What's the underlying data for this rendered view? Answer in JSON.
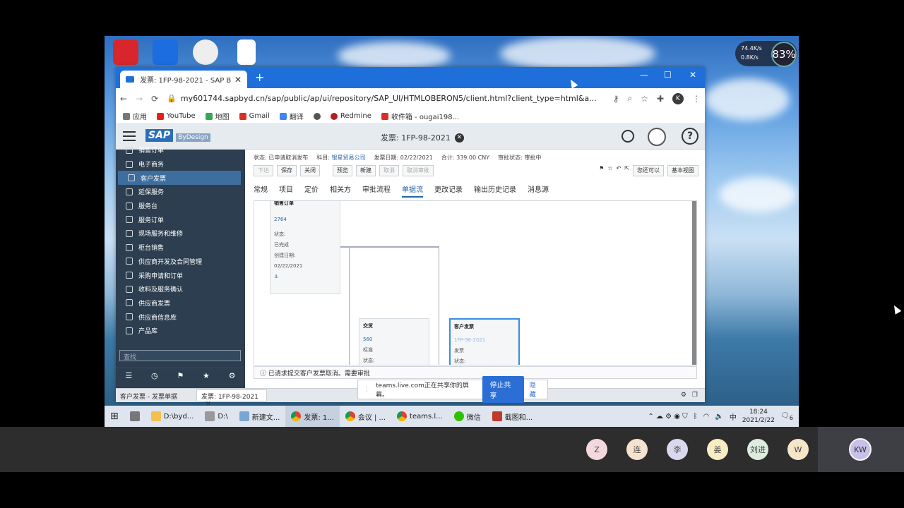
{
  "network_monitor": {
    "upload": "74.4K/s",
    "download": "0.8K/s",
    "cpu": "83%"
  },
  "browser": {
    "tab_title": "发票: 1FP-98-2021 - SAP Busin",
    "new_tab": "+",
    "url": "my601744.sapbyd.cn/sap/public/ap/ui/repository/SAP_UI/HTMLOBERON5/client.html?client_type=html&a...",
    "profile_initial": "K",
    "bookmarks": [
      "应用",
      "YouTube",
      "地图",
      "Gmail",
      "翻译",
      "Redmine",
      "收件箱 - ougai198..."
    ]
  },
  "sap": {
    "logo_text": "SAP",
    "logo_sub": "ByDesign",
    "doc_title": "发票: 1FP-98-2021",
    "sidebar": [
      {
        "label": "销售订单",
        "active": false
      },
      {
        "label": "电子商务",
        "active": false
      },
      {
        "label": "客户发票",
        "active": true
      },
      {
        "label": "延保服务",
        "active": false
      },
      {
        "label": "服务台",
        "active": false
      },
      {
        "label": "服务订单",
        "active": false
      },
      {
        "label": "现场服务和维修",
        "active": false
      },
      {
        "label": "柜台销售",
        "active": false
      },
      {
        "label": "供应商开发及合同管理",
        "active": false
      },
      {
        "label": "采购申请和订单",
        "active": false
      },
      {
        "label": "收料及服务确认",
        "active": false
      },
      {
        "label": "供应商发票",
        "active": false
      },
      {
        "label": "供应商信息库",
        "active": false
      },
      {
        "label": "产品库",
        "active": false
      }
    ],
    "search_placeholder": "查找",
    "header": {
      "status_label": "状态:",
      "status_value": "已申请取消发布",
      "account_label": "科目:",
      "account_value": "银星贸易公司",
      "date_label": "发票日期:",
      "date_value": "02/22/2021",
      "total_label": "合计:",
      "total_value": "339.00 CNY",
      "approval_label": "审批状态:",
      "approval_value": "审批中"
    },
    "toolbar": [
      {
        "label": "下达",
        "disabled": true
      },
      {
        "label": "保存",
        "disabled": false
      },
      {
        "label": "关闭",
        "disabled": false
      },
      {
        "label": "预览",
        "disabled": false
      },
      {
        "label": "新建",
        "disabled": false
      },
      {
        "label": "取消",
        "disabled": true
      },
      {
        "label": "取消审批",
        "disabled": true
      }
    ],
    "toolbar_right": [
      "您还可以",
      "基本视图"
    ],
    "tabs": [
      "常规",
      "项目",
      "定价",
      "相关方",
      "审批流程",
      "单据流",
      "更改记录",
      "输出历史记录",
      "消息源"
    ],
    "active_tab": "单据流",
    "flow_cards": {
      "sales_order": {
        "title": "销售订单",
        "id": "2764",
        "status_label": "状态:",
        "status": "已完成",
        "date_label": "创建日期:",
        "date": "02/22/2021"
      },
      "delivery": {
        "title": "交货",
        "id": "560",
        "type": "标准",
        "status_label": "状态:"
      },
      "invoice": {
        "title": "客户发票",
        "id": "1FP-98-2021",
        "type": "发票",
        "status_label": "状态:"
      }
    },
    "message": "已请求提交客户发票取消。需要审批",
    "status_left": "客户发票 - 发票单据",
    "status_tab": "发票: 1FP-98-2021"
  },
  "share_banner": {
    "text": "teams.live.com正在共享你的屏幕。",
    "stop": "停止共享",
    "hide": "隐藏"
  },
  "taskbar": {
    "items": [
      "D:\\byd...",
      "D:\\",
      "新建文...",
      "发票: 1...",
      "会议 | ...",
      "teams.l...",
      "微信",
      "截图和..."
    ],
    "ime": "中",
    "time": "18:24",
    "date": "2021/2/22",
    "notif_count": "6"
  },
  "participants": [
    "Z",
    "连",
    "李",
    "姜",
    "刘进",
    "W"
  ],
  "self": "KW",
  "colors": {
    "sap_blue": "#2563a8",
    "chrome_blue": "#1e6fd9",
    "sidebar": "#2c3e50",
    "teams_blue": "#2b6fd6"
  }
}
